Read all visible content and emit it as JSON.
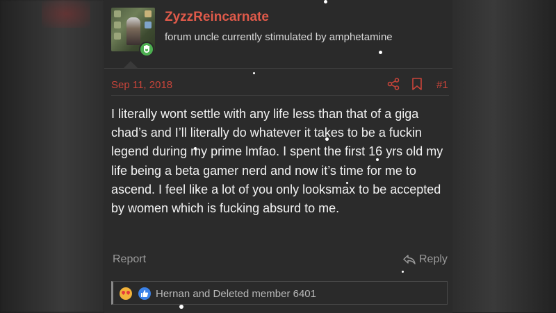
{
  "user": {
    "name": "ZyzzReincarnate",
    "title": "forum uncle currently stimulated by amphetamine"
  },
  "post": {
    "date": "Sep 11, 2018",
    "number": "#1",
    "body": "I literally wont settle with any life less than that of a giga chad’s and I’ll literally do whatever it takes to be a fuckin legend during my prime lmfao. I spent the first 16 yrs old my life being a beta gamer nerd and now it’s time for me to ascend. I feel like a lot of you only looksmax to be accepted by women which is fucking absurd to me."
  },
  "actions": {
    "report": "Report",
    "reply": "Reply"
  },
  "reactions": {
    "summary": "Hernan and Deleted member 6401",
    "icons": [
      "love-emoji-icon",
      "like-icon"
    ]
  },
  "colors": {
    "accent": "#e05a4a",
    "panel": "#2b2b2b",
    "text": "#f2f2f2",
    "muted": "#9a9a9a"
  }
}
